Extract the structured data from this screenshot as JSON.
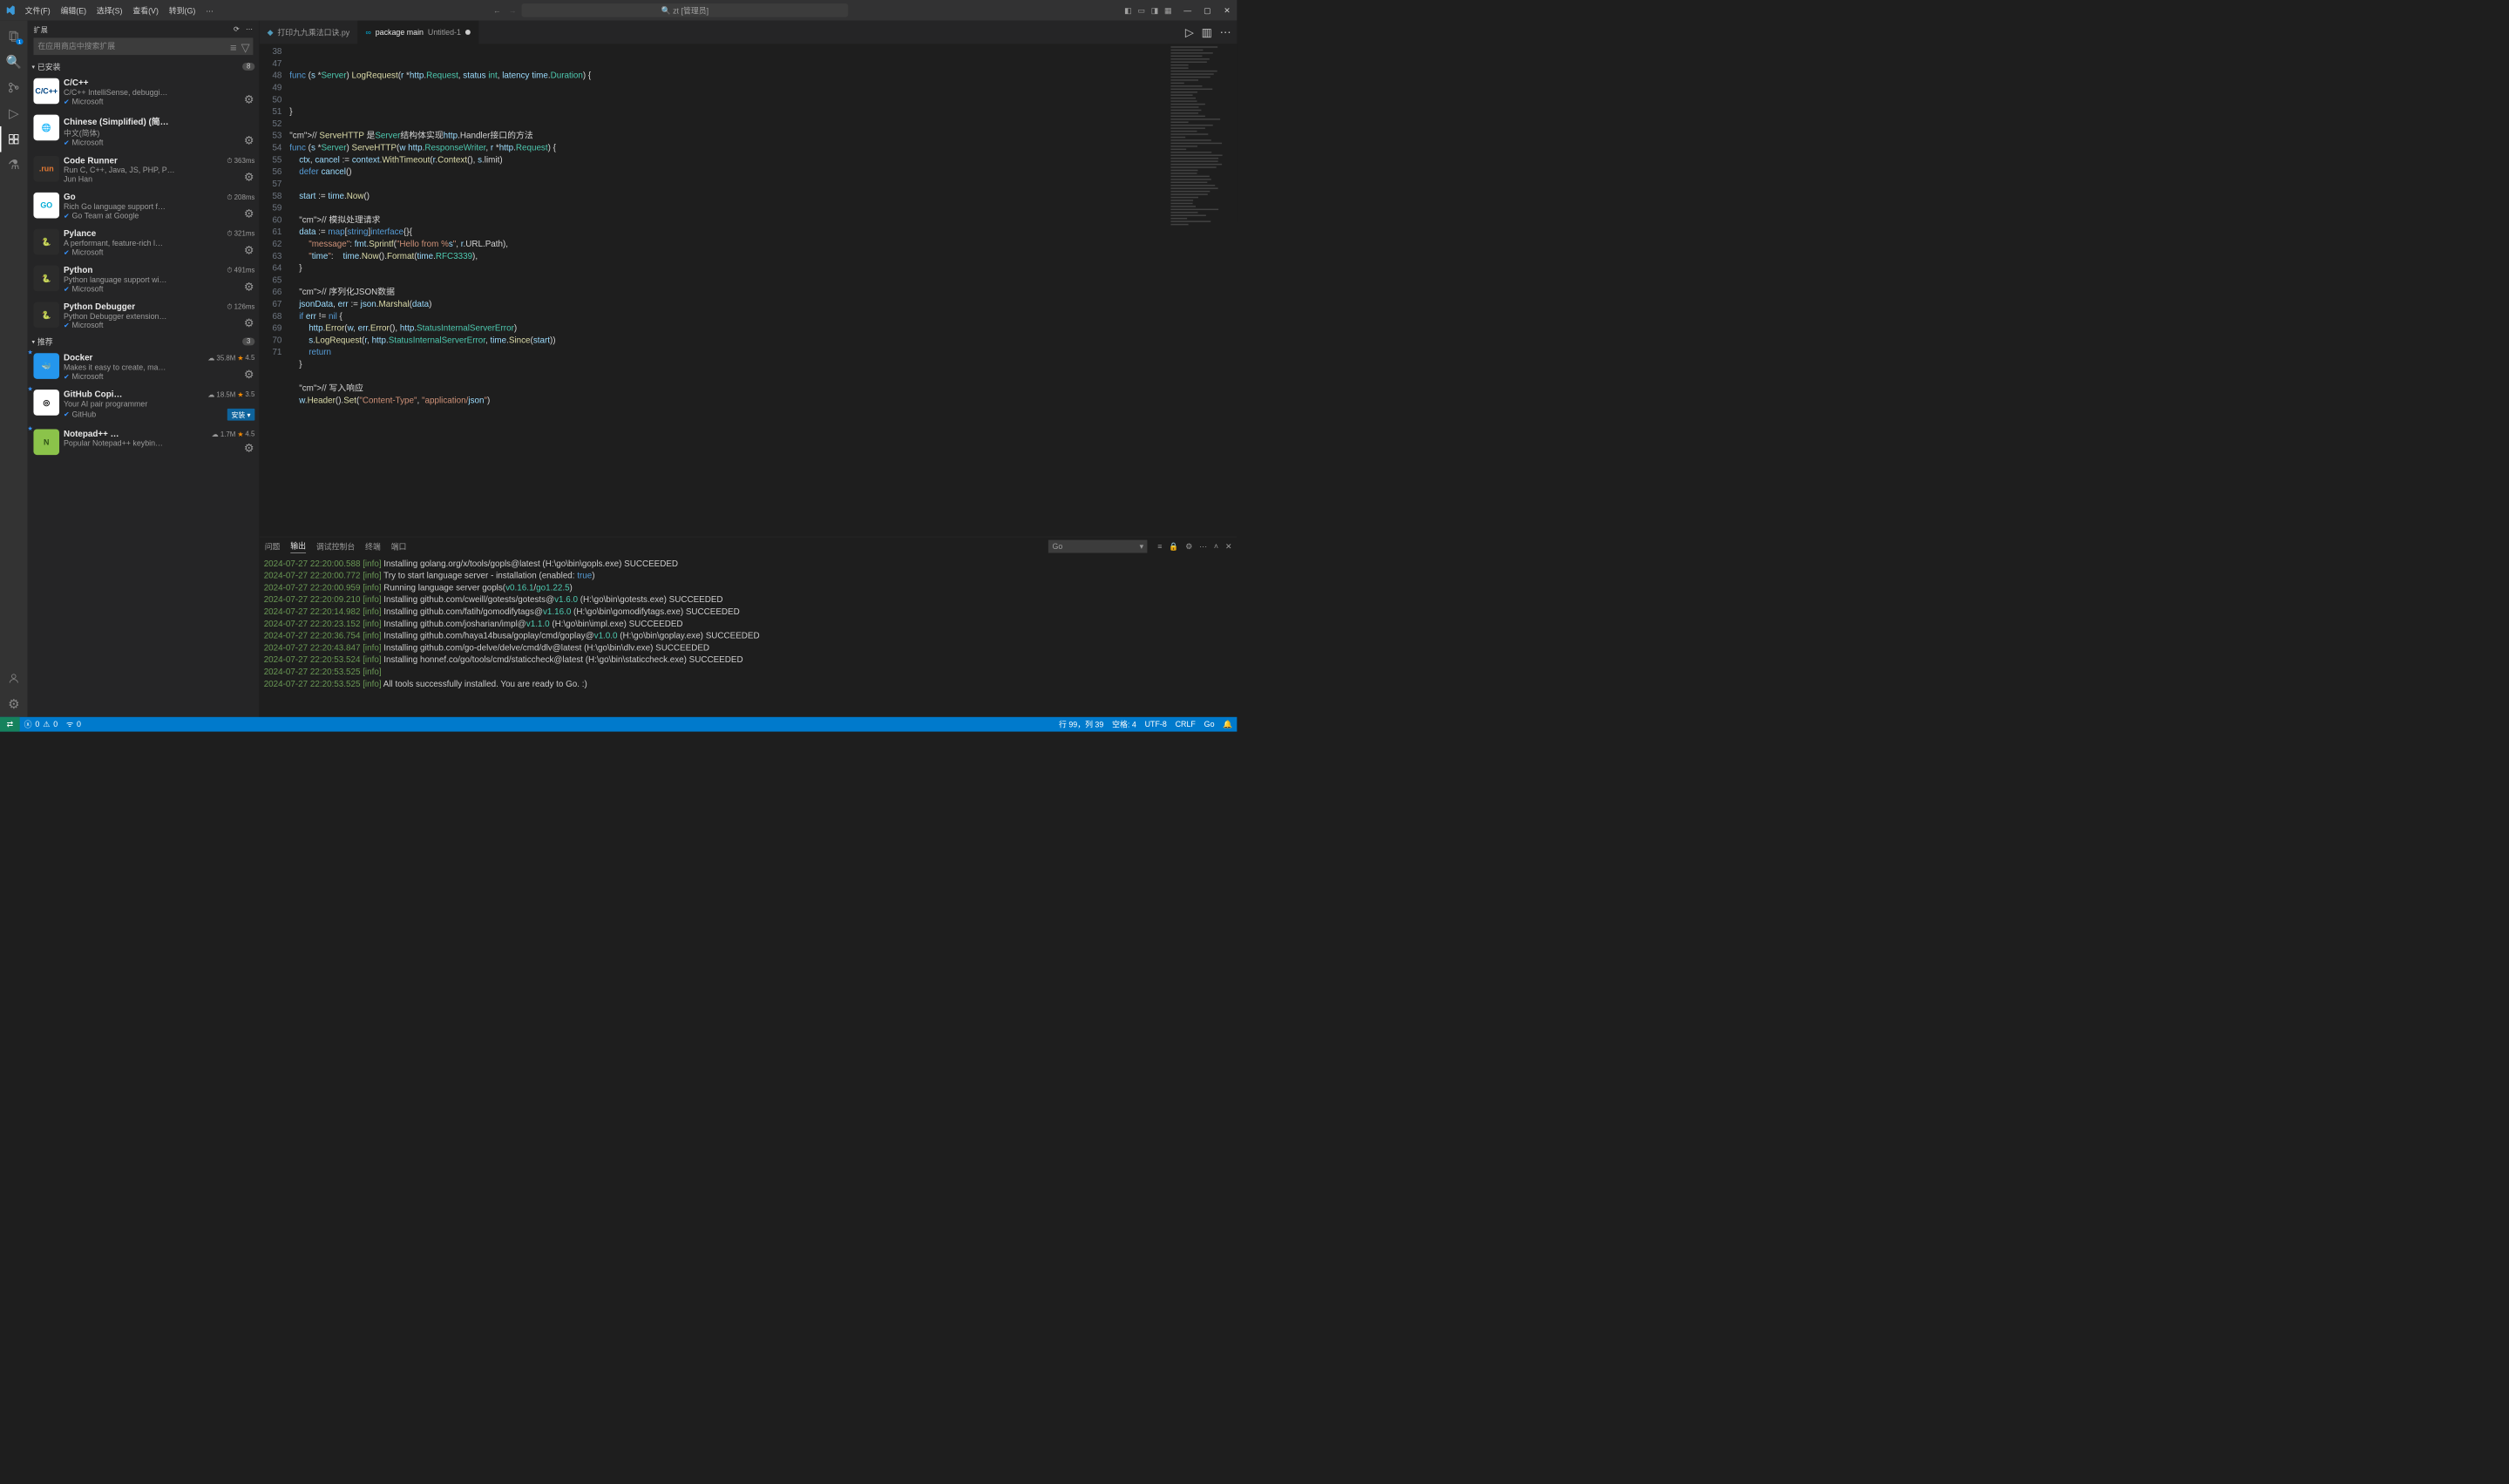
{
  "menu": {
    "items": [
      "文件(F)",
      "编辑(E)",
      "选择(S)",
      "查看(V)",
      "转到(G)",
      "…"
    ]
  },
  "search": {
    "text": "zt [管理员]"
  },
  "activity": {
    "badges": {
      "explorer": "1"
    }
  },
  "sidebar": {
    "title": "扩展",
    "placeholder": "在应用商店中搜索扩展",
    "installed_label": "已安装",
    "installed_count": "8",
    "recommended_label": "推荐",
    "recommended_count": "3"
  },
  "extensions_installed": [
    {
      "name": "C/C++",
      "desc": "C/C++ IntelliSense, debuggi…",
      "publisher": "Microsoft",
      "meta": "",
      "icon_bg": "#ffffff",
      "icon_fg": "#004482",
      "icon_text": "C/C++",
      "verified": true
    },
    {
      "name": "Chinese (Simplified) (简体…",
      "desc": "中文(简体)",
      "publisher": "Microsoft",
      "meta": "",
      "icon_bg": "#ffffff",
      "icon_fg": "#2f6db3",
      "icon_text": "🌐",
      "verified": true
    },
    {
      "name": "Code Runner",
      "desc": "Run C, C++, Java, JS, PHP, P…",
      "publisher": "Jun Han",
      "meta": "363ms",
      "icon_bg": "#2b2b2b",
      "icon_fg": "#e37933",
      "icon_text": ".run",
      "verified": false
    },
    {
      "name": "Go",
      "desc": "Rich Go language support f…",
      "publisher": "Go Team at Google",
      "meta": "208ms",
      "icon_bg": "#ffffff",
      "icon_fg": "#00acd7",
      "icon_text": "GO",
      "verified": true
    },
    {
      "name": "Pylance",
      "desc": "A performant, feature-rich l…",
      "publisher": "Microsoft",
      "meta": "321ms",
      "icon_bg": "#2b2b2b",
      "icon_fg": "#ffd43b",
      "icon_text": "🐍",
      "verified": true
    },
    {
      "name": "Python",
      "desc": "Python language support wi…",
      "publisher": "Microsoft",
      "meta": "491ms",
      "icon_bg": "#2b2b2b",
      "icon_fg": "#ffd43b",
      "icon_text": "🐍",
      "verified": true
    },
    {
      "name": "Python Debugger",
      "desc": "Python Debugger extension…",
      "publisher": "Microsoft",
      "meta": "126ms",
      "icon_bg": "#2b2b2b",
      "icon_fg": "#ffd43b",
      "icon_text": "🐍",
      "verified": true
    }
  ],
  "extensions_recommended": [
    {
      "name": "Docker",
      "desc": "Makes it easy to create, ma…",
      "publisher": "Microsoft",
      "meta": "35.8M",
      "rating": "4.5",
      "icon_bg": "#2496ed",
      "icon_fg": "#ffffff",
      "icon_text": "🐳",
      "verified": true
    },
    {
      "name": "GitHub Copi…",
      "desc": "Your AI pair programmer",
      "publisher": "GitHub",
      "meta": "18.5M",
      "rating": "3.5",
      "icon_bg": "#ffffff",
      "icon_fg": "#000000",
      "icon_text": "◎",
      "verified": true,
      "install": "安装"
    },
    {
      "name": "Notepad++ …",
      "desc": "Popular Notepad++ keybin…",
      "publisher": "",
      "meta": "1.7M",
      "rating": "4.5",
      "icon_bg": "#8bc34a",
      "icon_fg": "#2d5016",
      "icon_text": "N",
      "verified": false
    }
  ],
  "tabs": [
    {
      "label": "打印九九乘法口诀.py",
      "icon": "◆",
      "icon_color": "#519aba",
      "active": false
    },
    {
      "label": "package main",
      "sub": "Untitled-1",
      "icon": "∞",
      "icon_color": "#00acd7",
      "active": true,
      "dirty": true
    }
  ],
  "sticky": {
    "line": "38"
  },
  "gutter_start": 47,
  "gutter_end": 71,
  "code_sticky": "func (s *Server) LogRequest(r *http.Request, status int, latency time.Duration) {",
  "code_lines": [
    "}",
    "",
    "// ServeHTTP 是Server结构体实现http.Handler接口的方法",
    "func (s *Server) ServeHTTP(w http.ResponseWriter, r *http.Request) {",
    "    ctx, cancel := context.WithTimeout(r.Context(), s.limit)",
    "    defer cancel()",
    "",
    "    start := time.Now()",
    "",
    "    // 模拟处理请求",
    "    data := map[string]interface{}{",
    "        \"message\": fmt.Sprintf(\"Hello from %s\", r.URL.Path),",
    "        \"time\":    time.Now().Format(time.RFC3339),",
    "    }",
    "",
    "    // 序列化JSON数据",
    "    jsonData, err := json.Marshal(data)",
    "    if err != nil {",
    "        http.Error(w, err.Error(), http.StatusInternalServerError)",
    "        s.LogRequest(r, http.StatusInternalServerError, time.Since(start))",
    "        return",
    "    }",
    "",
    "    // 写入响应",
    "    w.Header().Set(\"Content-Type\", \"application/json\")"
  ],
  "panel": {
    "tabs": [
      "问题",
      "输出",
      "调试控制台",
      "终端",
      "端口"
    ],
    "active": 1,
    "selector": "Go",
    "output": [
      "2024-07-27 22:20:00.588 [info] Installing golang.org/x/tools/gopls@latest (H:\\go\\bin\\gopls.exe) SUCCEEDED",
      "2024-07-27 22:20:00.772 [info] Try to start language server - installation (enabled: true)",
      "2024-07-27 22:20:00.959 [info] Running language server gopls(v0.16.1/go1.22.5)",
      "2024-07-27 22:20:09.210 [info] Installing github.com/cweill/gotests/gotests@v1.6.0 (H:\\go\\bin\\gotests.exe) SUCCEEDED",
      "2024-07-27 22:20:14.982 [info] Installing github.com/fatih/gomodifytags@v1.16.0 (H:\\go\\bin\\gomodifytags.exe) SUCCEEDED",
      "2024-07-27 22:20:23.152 [info] Installing github.com/josharian/impl@v1.1.0 (H:\\go\\bin\\impl.exe) SUCCEEDED",
      "2024-07-27 22:20:36.754 [info] Installing github.com/haya14busa/goplay/cmd/goplay@v1.0.0 (H:\\go\\bin\\goplay.exe) SUCCEEDED",
      "2024-07-27 22:20:43.847 [info] Installing github.com/go-delve/delve/cmd/dlv@latest (H:\\go\\bin\\dlv.exe) SUCCEEDED",
      "2024-07-27 22:20:53.524 [info] Installing honnef.co/go/tools/cmd/staticcheck@latest (H:\\go\\bin\\staticcheck.exe) SUCCEEDED",
      "2024-07-27 22:20:53.525 [info]",
      "2024-07-27 22:20:53.525 [info] All tools successfully installed. You are ready to Go. :)"
    ]
  },
  "status": {
    "errors": "0",
    "warnings": "0",
    "ports": "0",
    "lncol": "行 99，列 39",
    "spaces": "空格: 4",
    "enc": "UTF-8",
    "eol": "CRLF",
    "lang": "Go"
  }
}
